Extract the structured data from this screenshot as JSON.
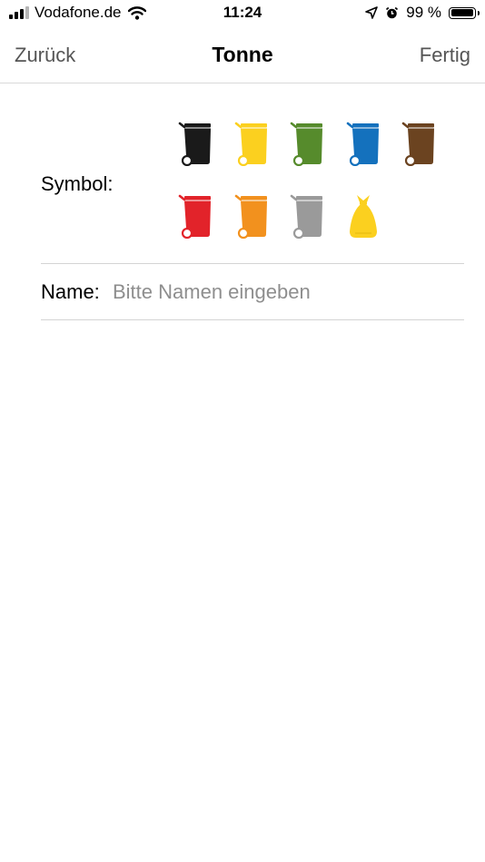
{
  "status_bar": {
    "carrier": "Vodafone.de",
    "time": "11:24",
    "battery_text": "99 %",
    "battery_level": 0.99,
    "icons": [
      "signal-icon",
      "wifi-icon",
      "location-arrow-icon",
      "alarm-icon",
      "battery-icon"
    ]
  },
  "nav": {
    "back_label": "Zurück",
    "title": "Tonne",
    "done_label": "Fertig"
  },
  "form": {
    "symbol_label": "Symbol:",
    "name_label": "Name:",
    "name_placeholder": "Bitte Namen eingeben",
    "name_value": ""
  },
  "symbols": [
    {
      "name": "bin-black-icon",
      "kind": "bin",
      "color": "#1a1a1a"
    },
    {
      "name": "bin-yellow-icon",
      "kind": "bin",
      "color": "#fbd01f"
    },
    {
      "name": "bin-green-icon",
      "kind": "bin",
      "color": "#568b2c"
    },
    {
      "name": "bin-blue-icon",
      "kind": "bin",
      "color": "#1471bd"
    },
    {
      "name": "bin-brown-icon",
      "kind": "bin",
      "color": "#6b4320"
    },
    {
      "name": "bin-red-icon",
      "kind": "bin",
      "color": "#e2232a"
    },
    {
      "name": "bin-orange-icon",
      "kind": "bin",
      "color": "#f2911e"
    },
    {
      "name": "bin-gray-icon",
      "kind": "bin",
      "color": "#9a9a9a"
    },
    {
      "name": "yellow-bag-icon",
      "kind": "bag",
      "color": "#fbd01f"
    }
  ]
}
